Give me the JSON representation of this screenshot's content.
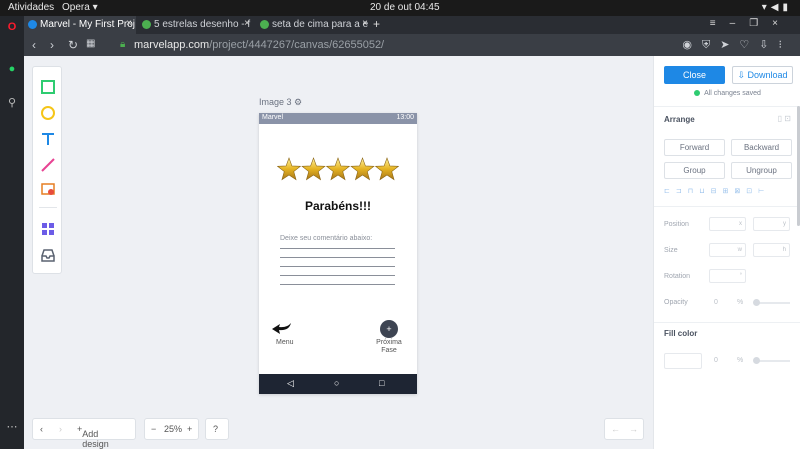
{
  "os_bar": {
    "activities": "Atividades",
    "browser": "Opera ▾",
    "clock": "20 de out  04:45"
  },
  "tabs": [
    {
      "label": "Marvel - My First Proj",
      "active": true,
      "favicon_color": "#1e88e5"
    },
    {
      "label": "5 estrelas desenho - f",
      "active": false,
      "favicon_color": "#4caf50"
    },
    {
      "label": "seta de cima para a e",
      "active": false,
      "favicon_color": "#4caf50"
    }
  ],
  "address": {
    "host": "marvelapp.com",
    "path": "/project/4447267/canvas/62655052/"
  },
  "canvas": {
    "image_label": "Image 3",
    "phone": {
      "status_left": "Marvel",
      "status_right": "13:00",
      "star_count": 5,
      "title": "Parabéns!!!",
      "prompt": "Deixe seu comentário abaixo:",
      "back_label": "Menu",
      "next_label": "Próxima Fase",
      "next_icon": "+"
    },
    "bottom": {
      "add_design": "Add design",
      "zoom": "25%"
    }
  },
  "panel": {
    "close_label": "Close",
    "download_label": "Download",
    "saved_text": "All changes saved",
    "arrange_title": "Arrange",
    "buttons": [
      "Forward",
      "Backward",
      "Group",
      "Ungroup"
    ],
    "props": {
      "position": "Position",
      "size": "Size",
      "rotation": "Rotation",
      "opacity": "Opacity"
    },
    "opacity_value": "0",
    "opacity_unit": "%",
    "fill_title": "Fill color",
    "fill_value": "0",
    "fill_unit": "%"
  },
  "colors": {
    "accent": "#1e88e5",
    "saved": "#2ecc71",
    "navbar": "#1e2533"
  }
}
